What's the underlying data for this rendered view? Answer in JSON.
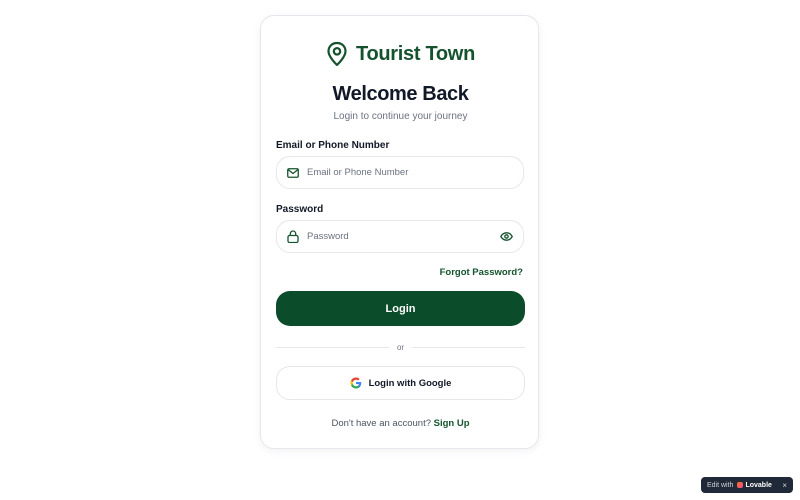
{
  "brand": {
    "name": "Tourist Town",
    "icon": "map-pin-icon",
    "color": "#14532d"
  },
  "header": {
    "title": "Welcome Back",
    "subtitle": "Login to continue your journey"
  },
  "form": {
    "email": {
      "label": "Email or Phone Number",
      "placeholder": "Email or Phone Number",
      "value": "",
      "icon": "mail-icon"
    },
    "password": {
      "label": "Password",
      "placeholder": "Password",
      "value": "",
      "icon": "lock-icon",
      "toggle_icon": "eye-icon"
    },
    "forgot_label": "Forgot Password?",
    "login_label": "Login",
    "login_color": "#0b4d2a"
  },
  "divider": {
    "label": "or"
  },
  "google": {
    "label": "Login with Google",
    "icon": "google-icon"
  },
  "signup": {
    "prompt": "Don't have an account?",
    "link_label": "Sign Up"
  },
  "badge": {
    "prefix": "Edit with",
    "brand": "Lovable",
    "close": "×"
  }
}
